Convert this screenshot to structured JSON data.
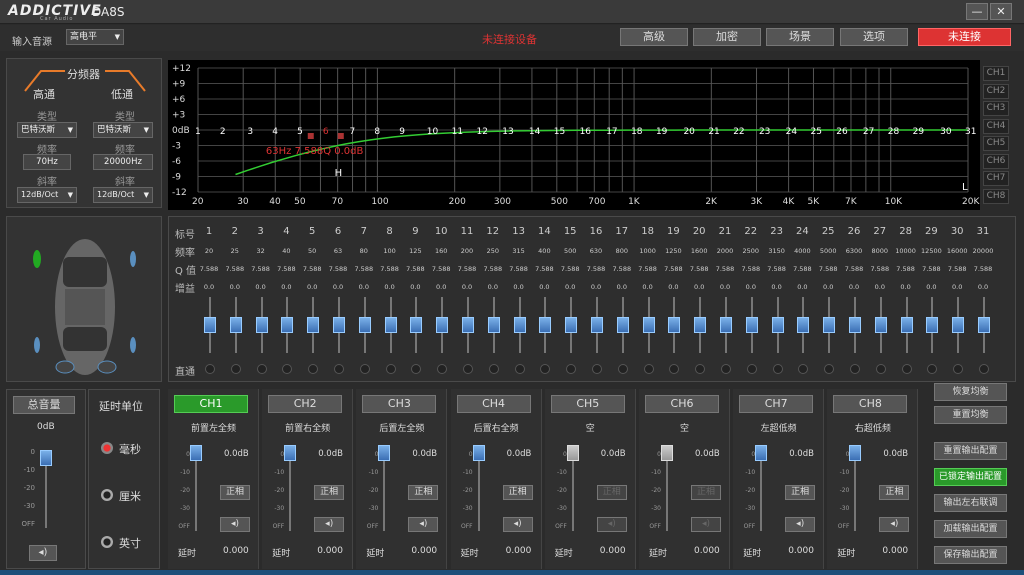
{
  "app": {
    "brand": "ADDICTIVE",
    "brand_sub": "Car Audio",
    "model": "DA8S"
  },
  "window": {
    "minimize": "—",
    "close": "✕"
  },
  "top": {
    "input_label": "输入音源",
    "input_value": "高电平",
    "status_text": "未连接设备",
    "buttons": [
      "高级",
      "加密",
      "场景",
      "选项"
    ],
    "connect": "未连接"
  },
  "crossover": {
    "title": "分频器",
    "hp": {
      "label": "高通",
      "type_label": "类型",
      "type": "巴特沃斯",
      "freq_label": "频率",
      "freq": "70Hz",
      "slope_label": "斜率",
      "slope": "12dB/Oct"
    },
    "lp": {
      "label": "低通",
      "type_label": "类型",
      "type": "巴特沃斯",
      "freq_label": "频率",
      "freq": "20000Hz",
      "slope_label": "斜率",
      "slope": "12dB/Oct"
    }
  },
  "graph": {
    "y_ticks": [
      "+12",
      "+9",
      "+6",
      "+3",
      "0dB",
      "-3",
      "-6",
      "-9",
      "-12"
    ],
    "x_ticks": [
      "20",
      "30",
      "40",
      "50",
      "70",
      "100",
      "200",
      "300",
      "500",
      "700",
      "1K",
      "2K",
      "3K",
      "4K",
      "5K",
      "7K",
      "10K",
      "20K"
    ],
    "band_markers": [
      "1",
      "2",
      "3",
      "4",
      "5",
      "6",
      "7",
      "8",
      "9",
      "10",
      "11",
      "12",
      "13",
      "14",
      "15",
      "16",
      "17",
      "18",
      "19",
      "20",
      "21",
      "22",
      "23",
      "24",
      "25",
      "26",
      "27",
      "28",
      "29",
      "30",
      "31"
    ],
    "readout": "63Hz 7.588Q 0.0dB",
    "l_marker": "L",
    "h_marker": "H",
    "ch_tabs": [
      "CH1",
      "CH2",
      "CH3",
      "CH4",
      "CH5",
      "CH6",
      "CH7",
      "CH8"
    ]
  },
  "eq": {
    "label_band": "标号",
    "label_freq": "频率",
    "label_q": "Q 值",
    "label_gain": "增益",
    "label_bypass": "直通",
    "freqs": [
      "20",
      "25",
      "32",
      "40",
      "50",
      "63",
      "80",
      "100",
      "125",
      "160",
      "200",
      "250",
      "315",
      "400",
      "500",
      "630",
      "800",
      "1000",
      "1250",
      "1600",
      "2000",
      "2500",
      "3150",
      "4000",
      "5000",
      "6300",
      "8000",
      "10000",
      "12500",
      "16000",
      "20000"
    ],
    "q": "7.588",
    "gain": "0.0",
    "restore": "恢复均衡",
    "reset": "重置均衡"
  },
  "master": {
    "label": "总音量",
    "value": "0dB",
    "scale": [
      "0",
      "-10",
      "-20",
      "-30",
      "OFF"
    ]
  },
  "delay": {
    "title": "延时单位",
    "options": [
      "毫秒",
      "厘米",
      "英寸"
    ]
  },
  "channels": [
    {
      "btn": "CH1",
      "name": "前置左全频",
      "db": "0.0dB",
      "phase": "正相",
      "delay_label": "延时",
      "delay": "0.000",
      "active": true
    },
    {
      "btn": "CH2",
      "name": "前置右全频",
      "db": "0.0dB",
      "phase": "正相",
      "delay_label": "延时",
      "delay": "0.000"
    },
    {
      "btn": "CH3",
      "name": "后置左全频",
      "db": "0.0dB",
      "phase": "正相",
      "delay_label": "延时",
      "delay": "0.000"
    },
    {
      "btn": "CH4",
      "name": "后置右全频",
      "db": "0.0dB",
      "phase": "正相",
      "delay_label": "延时",
      "delay": "0.000"
    },
    {
      "btn": "CH5",
      "name": "空",
      "db": "0.0dB",
      "phase": "正相",
      "delay_label": "延时",
      "delay": "0.000"
    },
    {
      "btn": "CH6",
      "name": "空",
      "db": "0.0dB",
      "phase": "正相",
      "delay_label": "延时",
      "delay": "0.000"
    },
    {
      "btn": "CH7",
      "name": "左超低频",
      "db": "0.0dB",
      "phase": "正相",
      "delay_label": "延时",
      "delay": "0.000"
    },
    {
      "btn": "CH8",
      "name": "右超低频",
      "db": "0.0dB",
      "phase": "正相",
      "delay_label": "延时",
      "delay": "0.000"
    }
  ],
  "ch_scale": [
    "0",
    "-10",
    "-20",
    "-30",
    "OFF"
  ],
  "output": [
    "重置输出配置",
    "已锁定输出配置",
    "输出左右联调",
    "加载输出配置",
    "保存输出配置"
  ],
  "colors": {
    "accent": "#e87b2a",
    "active_green": "#2a9a2a",
    "red": "#d33333"
  }
}
